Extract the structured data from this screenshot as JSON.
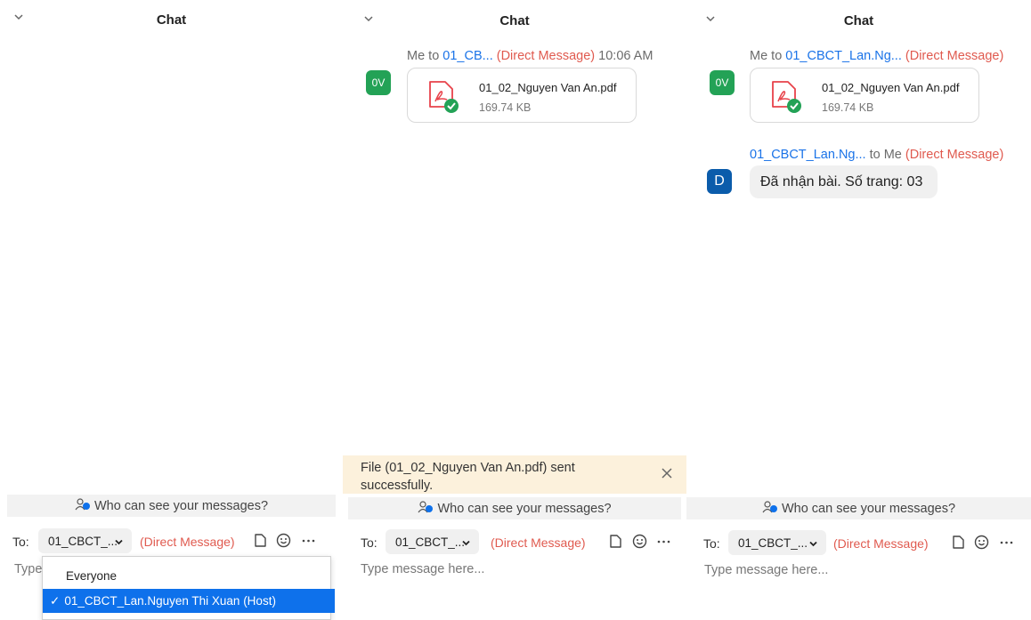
{
  "panels": [
    {
      "title": "Chat",
      "who_text": "Who can see your messages?",
      "to_label": "To:",
      "to_value": "01_CBCT_...",
      "dm_label": "(Direct Message)",
      "type_placeholder": "Type",
      "dropdown": {
        "everyone": "Everyone",
        "host_item": "01_CBCT_Lan.Nguyen Thi Xuan (Host)",
        "check": "✓"
      }
    },
    {
      "title": "Chat",
      "message": {
        "sender": "Me to ",
        "recipient": "01_CB...",
        "dm": "(Direct Message)",
        "time": "10:06 AM",
        "avatar": "0V",
        "file_name": "01_02_Nguyen Van An.pdf",
        "file_size": "169.74 KB"
      },
      "notice": "File (01_02_Nguyen Van An.pdf) sent successfully.",
      "who_text": "Who can see your messages?",
      "to_label": "To:",
      "to_value": "01_CBCT_...",
      "dm_label": "(Direct Message)",
      "type_placeholder": "Type message here..."
    },
    {
      "title": "Chat",
      "message1": {
        "sender": "Me to ",
        "recipient": "01_CBCT_Lan.Ng...",
        "dm": "(Direct Message)",
        "avatar": "0V",
        "file_name": "01_02_Nguyen Van An.pdf",
        "file_size": "169.74 KB"
      },
      "message2": {
        "sender": "01_CBCT_Lan.Ng...",
        "to_me": " to Me",
        "dm": "(Direct Message)",
        "avatar": "D",
        "text": "Đã nhận bài. Số trang: 03"
      },
      "who_text": "Who can see your messages?",
      "to_label": "To:",
      "to_value": "01_CBCT_...",
      "dm_label": "(Direct Message)",
      "type_placeholder": "Type message here..."
    }
  ],
  "icons": {
    "collapse": "chevron-down-icon",
    "pdf": "pdf-file-icon",
    "sent_check": "check-circle-icon",
    "who": "people-icon",
    "file": "file-icon",
    "emoji": "emoji-icon",
    "more": "more-icon",
    "close": "close-icon"
  },
  "colors": {
    "accent_blue": "#1a73e8",
    "direct_message_red": "#e05a4f",
    "avatar_green": "#23a256",
    "avatar_blue": "#0b5cab",
    "selected_blue": "#0e71eb",
    "notice_bg": "#fcf1dc",
    "pdf_red": "#e8424a",
    "check_green": "#23a256"
  }
}
